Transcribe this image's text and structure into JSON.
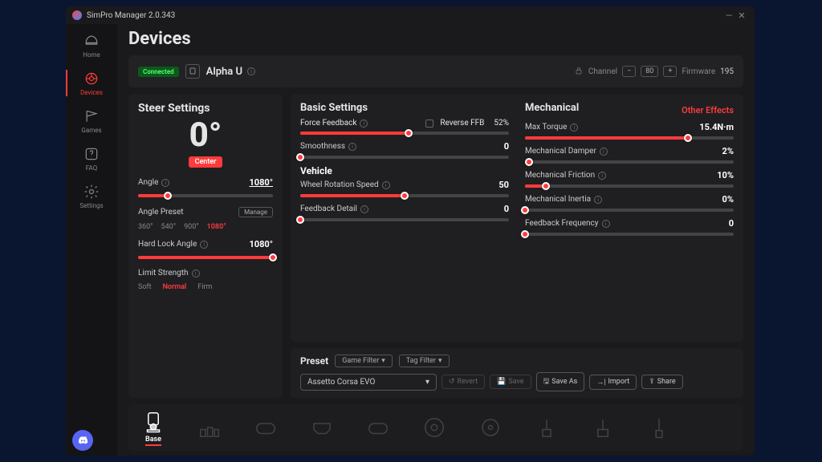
{
  "titlebar": {
    "title": "SimPro Manager 2.0.343"
  },
  "sidebar": {
    "items": [
      {
        "label": "Home"
      },
      {
        "label": "Devices"
      },
      {
        "label": "Games"
      },
      {
        "label": "FAQ"
      },
      {
        "label": "Settings"
      }
    ]
  },
  "page": {
    "title": "Devices"
  },
  "device": {
    "status": "Connected",
    "name": "Alpha U",
    "channel_label": "Channel",
    "channel": "80",
    "firmware_label": "Firmware",
    "firmware": "195"
  },
  "steer": {
    "title": "Steer Settings",
    "big_value": "0°",
    "center": "Center",
    "angle_label": "Angle",
    "angle_value": "1080°",
    "angle_preset_label": "Angle Preset",
    "manage": "Manage",
    "presets": [
      "360°",
      "540°",
      "900°",
      "1080°"
    ],
    "preset_active": "1080°",
    "hard_lock_label": "Hard Lock Angle",
    "hard_lock_value": "1080°",
    "limit_label": "Limit Strength",
    "limit_options": [
      "Soft",
      "Normal",
      "Firm"
    ],
    "limit_active": "Normal"
  },
  "basic": {
    "title": "Basic Settings",
    "ffb_label": "Force Feedback",
    "reverse_label": "Reverse FFB",
    "ffb_value": "52%",
    "smooth_label": "Smoothness",
    "smooth_value": "0"
  },
  "vehicle": {
    "title": "Vehicle",
    "wrs_label": "Wheel Rotation Speed",
    "wrs_value": "50",
    "fd_label": "Feedback Detail",
    "fd_value": "0"
  },
  "mech": {
    "title": "Mechanical",
    "other": "Other Effects",
    "torque_label": "Max Torque",
    "torque_value": "15.4N·m",
    "damper_label": "Mechanical Damper",
    "damper_value": "2%",
    "friction_label": "Mechanical Friction",
    "friction_value": "10%",
    "inertia_label": "Mechanical Inertia",
    "inertia_value": "0%",
    "freq_label": "Feedback Frequency",
    "freq_value": "0"
  },
  "preset": {
    "title": "Preset",
    "game_filter": "Game Filter",
    "tag_filter": "Tag Filter",
    "selected": "Assetto Corsa EVO",
    "revert": "Revert",
    "save": "Save",
    "save_as": "Save As",
    "import": "Import",
    "share": "Share"
  },
  "device_tabs": {
    "base": "Base"
  }
}
